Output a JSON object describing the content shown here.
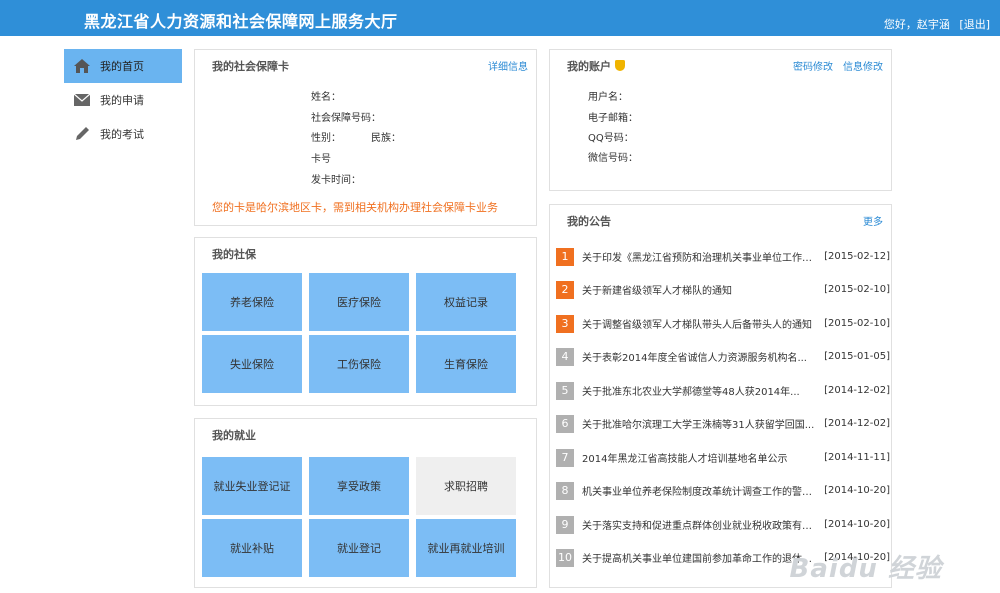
{
  "header": {
    "title": "黑龙江省人力资源和社会保障网上服务大厅",
    "greeting": "您好，赵宇涵",
    "logout": "[退出]"
  },
  "sidebar": {
    "items": [
      {
        "label": "我的首页",
        "icon": "home-icon"
      },
      {
        "label": "我的申请",
        "icon": "mail-icon"
      },
      {
        "label": "我的考试",
        "icon": "pencil-icon"
      }
    ]
  },
  "card": {
    "title": "我的社会保障卡",
    "detail_link": "详细信息",
    "fields": {
      "name": "姓名：",
      "ss_number": "社会保障号码：",
      "gender": "性别：",
      "ethnicity": "民族：",
      "card_no": "卡号",
      "issue_time": "发卡时间："
    },
    "note": "您的卡是哈尔滨地区卡，需到相关机构办理社会保障卡业务"
  },
  "insurance": {
    "title": "我的社保",
    "tiles": [
      "养老保险",
      "医疗保险",
      "权益记录",
      "失业保险",
      "工伤保险",
      "生育保险"
    ]
  },
  "employment": {
    "title": "我的就业",
    "tiles": [
      "就业失业登记证",
      "享受政策",
      "求职招聘",
      "就业补贴",
      "就业登记",
      "就业再就业培训"
    ]
  },
  "account": {
    "title": "我的账户",
    "password_link": "密码修改",
    "info_link": "信息修改",
    "fields": {
      "username": "用户名：",
      "email": "电子邮箱：",
      "qq": "QQ号码：",
      "wechat": "微信号码："
    }
  },
  "notices": {
    "title": "我的公告",
    "more": "更多",
    "items": [
      {
        "num": "1",
        "title": "关于印发《黑龙江省预防和治理机关事业单位工作人...",
        "date": "[2015-02-12]"
      },
      {
        "num": "2",
        "title": "关于新建省级领军人才梯队的通知",
        "date": "[2015-02-10]"
      },
      {
        "num": "3",
        "title": "关于调整省级领军人才梯队带头人后备带头人的通知",
        "date": "[2015-02-10]"
      },
      {
        "num": "4",
        "title": "关于表彰2014年度全省诚信人力资源服务机构名...",
        "date": "[2015-01-05]"
      },
      {
        "num": "5",
        "title": "关于批准东北农业大学郝德堂等48人获2014年...",
        "date": "[2014-12-02]"
      },
      {
        "num": "6",
        "title": "关于批准哈尔滨理工大学王洙楠等31人获留学回国...",
        "date": "[2014-12-02]"
      },
      {
        "num": "7",
        "title": "2014年黑龙江省高技能人才培训基地名单公示",
        "date": "[2014-11-11]"
      },
      {
        "num": "8",
        "title": "机关事业单位养老保险制度改革统计调查工作的警办...",
        "date": "[2014-10-20]"
      },
      {
        "num": "9",
        "title": "关于落实支持和促进重点群体创业就业税收政策有关...",
        "date": "[2014-10-20]"
      },
      {
        "num": "10",
        "title": "关于提高机关事业单位建国前参加革命工作的退休干...",
        "date": "[2014-10-20]"
      }
    ]
  },
  "watermark": "Baidu 经验",
  "colors": {
    "header": "#2f8fd8",
    "tile": "#7cbdf5",
    "tile_grey": "#efefef",
    "hot_number": "#f07020",
    "normal_number": "#b0b0b0",
    "link": "#2a8ad4",
    "note": "#f07020"
  }
}
